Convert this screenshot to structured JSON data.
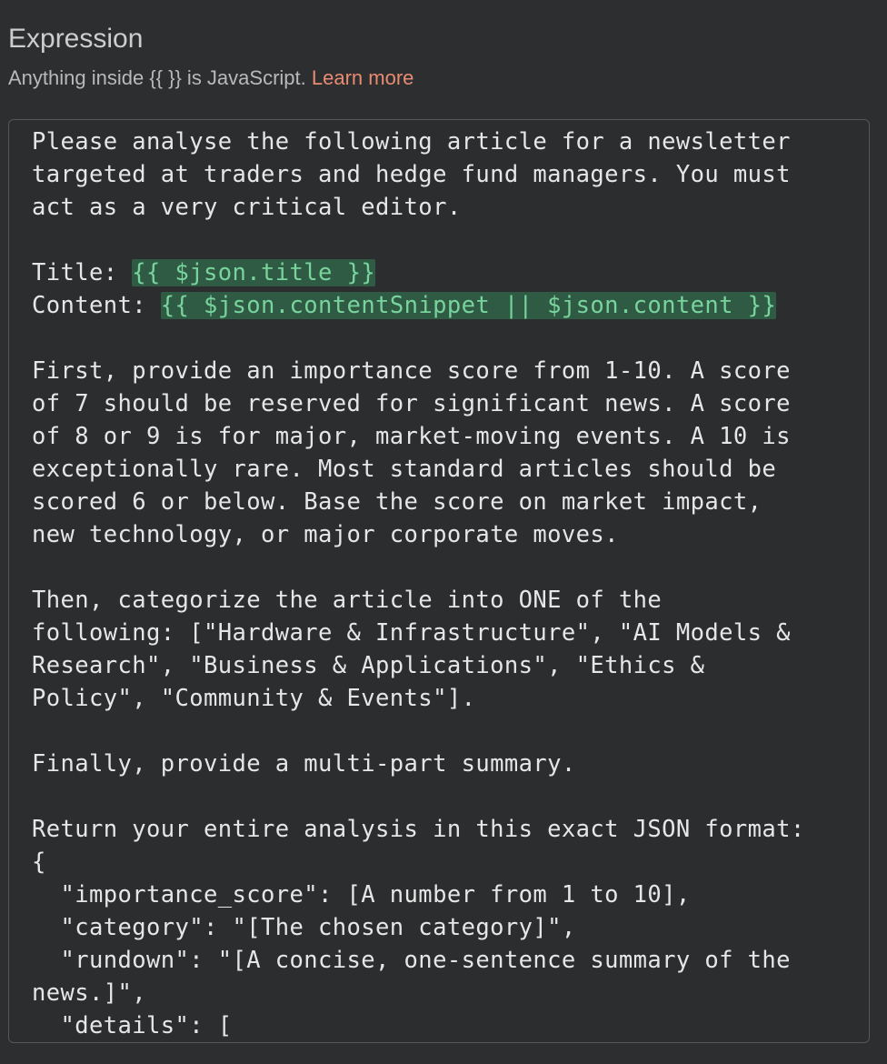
{
  "header": {
    "title": "Expression",
    "hint_prefix": "Anything inside {{ }} is JavaScript. ",
    "learn_more": "Learn more"
  },
  "editor": {
    "lines": [
      {
        "text": "Please analyse the following article for a newsletter"
      },
      {
        "text": "targeted at traders and hedge fund managers. You must"
      },
      {
        "text": "act as a very critical editor."
      },
      {
        "text": ""
      },
      {
        "text": "Title: ",
        "expr": "{{ $json.title }}"
      },
      {
        "text": "Content: ",
        "expr": "{{ $json.contentSnippet || $json.content }}"
      },
      {
        "text": ""
      },
      {
        "text": "First, provide an importance score from 1-10. A score"
      },
      {
        "text": "of 7 should be reserved for significant news. A score"
      },
      {
        "text": "of 8 or 9 is for major, market-moving events. A 10 is"
      },
      {
        "text": "exceptionally rare. Most standard articles should be"
      },
      {
        "text": "scored 6 or below. Base the score on market impact,"
      },
      {
        "text": "new technology, or major corporate moves."
      },
      {
        "text": ""
      },
      {
        "text": "Then, categorize the article into ONE of the"
      },
      {
        "text": "following: [\"Hardware & Infrastructure\", \"AI Models &"
      },
      {
        "text": "Research\", \"Business & Applications\", \"Ethics &"
      },
      {
        "text": "Policy\", \"Community & Events\"]."
      },
      {
        "text": ""
      },
      {
        "text": "Finally, provide a multi-part summary."
      },
      {
        "text": ""
      },
      {
        "text": "Return your entire analysis in this exact JSON format:"
      },
      {
        "text": "{"
      },
      {
        "text": "  \"importance_score\": [A number from 1 to 10],"
      },
      {
        "text": "  \"category\": \"[The chosen category]\","
      },
      {
        "text": "  \"rundown\": \"[A concise, one-sentence summary of the"
      },
      {
        "text": "news.]\","
      },
      {
        "text": "  \"details\": ["
      }
    ]
  },
  "colors": {
    "background": "#2d2e30",
    "link": "#e98b72",
    "expression_text": "#79d39c",
    "expression_bg": "#2f5b45"
  }
}
